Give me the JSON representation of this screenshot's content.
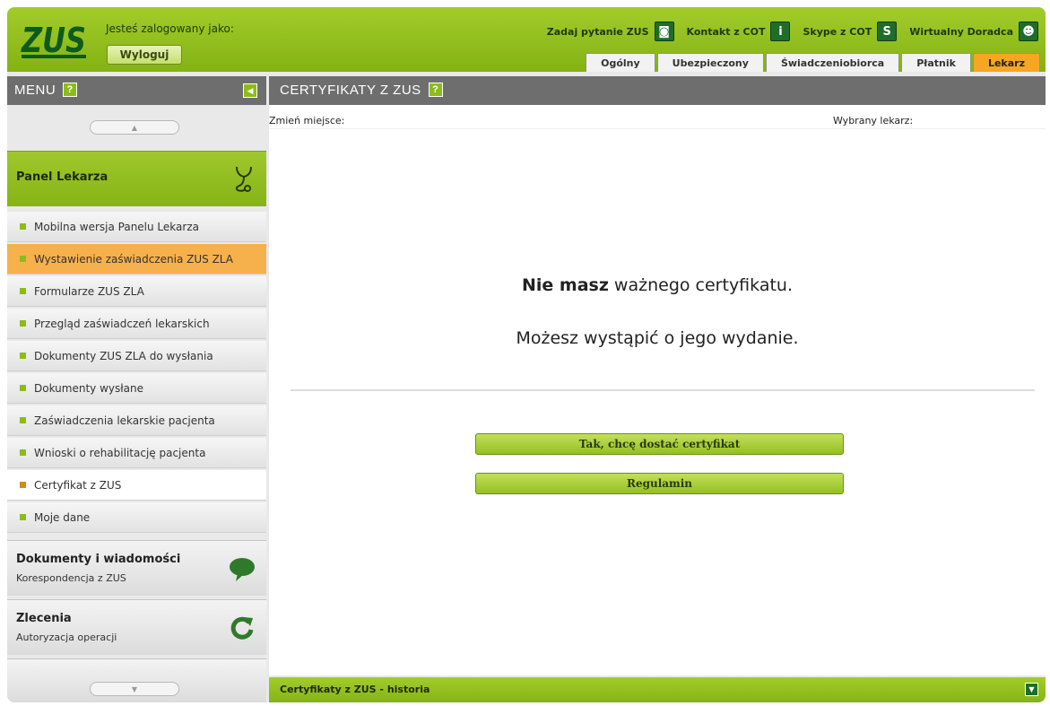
{
  "header": {
    "logo_text": "ZUS",
    "logged_as": "Jesteś zalogowany jako:",
    "logout": "Wyloguj",
    "links": [
      {
        "label": "Zadaj pytanie ZUS",
        "icon": "question-bubble-icon"
      },
      {
        "label": "Kontakt z COT",
        "icon": "info-icon"
      },
      {
        "label": "Skype z COT",
        "icon": "skype-icon"
      },
      {
        "label": "Wirtualny Doradca",
        "icon": "advisor-icon"
      }
    ],
    "tabs": [
      "Ogólny",
      "Ubezpieczony",
      "Świadczeniobiorca",
      "Płatnik",
      "Lekarz"
    ],
    "active_tab": "Lekarz"
  },
  "sidebar": {
    "title": "MENU",
    "help": "?",
    "panel_title": "Panel Lekarza",
    "items": [
      "Mobilna wersja Panelu Lekarza",
      "Wystawienie zaświadczenia ZUS ZLA",
      "Formularze ZUS ZLA",
      "Przegląd zaświadczeń lekarskich",
      "Dokumenty ZUS ZLA do wysłania",
      "Dokumenty wysłane",
      "Zaświadczenia lekarskie pacjenta",
      "Wnioski o rehabilitację pacjenta",
      "Certyfikat z ZUS",
      "Moje dane"
    ],
    "sections": [
      {
        "title": "Dokumenty i wiadomości",
        "subtitle": "Korespondencja z ZUS"
      },
      {
        "title": "Zlecenia",
        "subtitle": "Autoryzacja operacji"
      }
    ]
  },
  "main": {
    "title": "CERTYFIKATY Z ZUS",
    "help": "?",
    "change_place_label": "Zmień miejsce:",
    "selected_doctor_label": "Wybrany lekarz:",
    "message_bold": "Nie masz",
    "message_rest": " ważnego certyfikatu.",
    "message2": "Możesz wystąpić o jego wydanie.",
    "btn_get_cert": "Tak, chcę dostać certyfikat",
    "btn_regulamin": "Regulamin",
    "history_title": "Certyfikaty z ZUS - historia"
  },
  "colors": {
    "accent_green": "#8dbb1b",
    "active_orange": "#f5a623",
    "bar_gray": "#6e6e6e"
  }
}
